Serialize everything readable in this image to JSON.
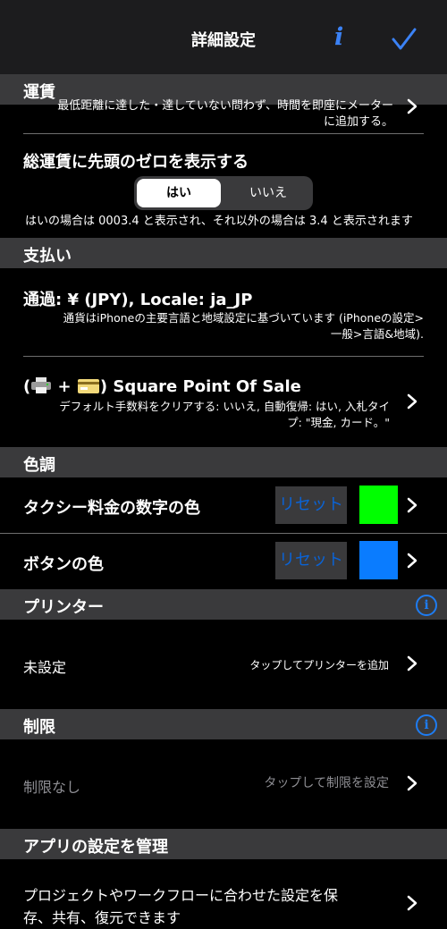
{
  "nav": {
    "title": "詳細設定",
    "info_glyph": "i",
    "done_icon": "checkmark-icon"
  },
  "sections": {
    "fare": "運賃",
    "payment": "支払い",
    "color": "色調",
    "printer": "プリンター",
    "limit": "制限",
    "app_settings": "アプリの設定を管理"
  },
  "fare": {
    "cutoff_line1": "最低距離に達した・達していない問わず、時間を即座にメーター",
    "cutoff_line2": "に追加する。",
    "leading_zero_title": "総運賃に先頭のゼロを表示する",
    "seg_yes": "はい",
    "seg_no": "いいえ",
    "leading_zero_note": "はいの場合は 0003.4 と表示され、それ以外の場合は 3.4 と表示されます"
  },
  "payment": {
    "currency_title": "通過: ¥ (JPY), Locale: ja_JP",
    "currency_note_line1": "通貨はiPhoneの主要言語と地域設定に基づいています (iPhoneの設定>",
    "currency_note_line2": "一般>言語&地域).",
    "square_prefix": "(",
    "square_plus": " + ",
    "square_title": ") Square Point Of Sale",
    "square_note_line1": "デフォルト手数料をクリアする: いいえ, 自動復帰: はい, 入札タイ",
    "square_note_line2": "プ: \"現金, カード。\""
  },
  "color": {
    "taxi_digits_label": "タクシー料金の数字の色",
    "taxi_digits_reset": "リセット",
    "taxi_digits_color": "#00ff00",
    "button_color_label": "ボタンの色",
    "button_color_reset": "リセット",
    "button_color_color": "#0a7cff"
  },
  "printer": {
    "value": "未設定",
    "hint": "タップしてプリンターを追加",
    "info_glyph": "i"
  },
  "limit": {
    "value": "制限なし",
    "hint": "タップして制限を設定",
    "info_glyph": "i"
  },
  "app_settings": {
    "line1": "プロジェクトやワークフローに合わせた設定を保",
    "line2": "存、共有、復元できます"
  },
  "colors": {
    "accent": "#1e7cf2",
    "header_bg": "#3a3a3c",
    "nav_bg": "#1c1c1e"
  }
}
